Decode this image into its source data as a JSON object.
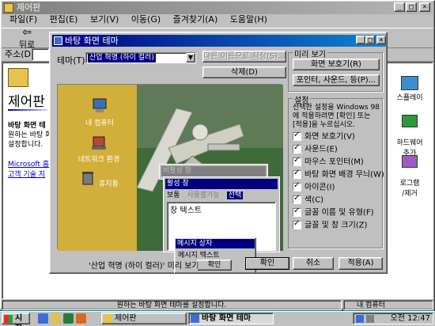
{
  "explorer": {
    "title": "제어판",
    "menu": [
      "파일(F)",
      "편집(E)",
      "보기(V)",
      "이동(G)",
      "즐겨찾기(A)",
      "도움말(H)"
    ],
    "back_label": "뒤로",
    "address_label": "주소(D)",
    "panel_title": "제어판",
    "desc_bold": "바탕 화면 테",
    "desc_line1": "원하는 바탕 화",
    "desc_line2": "설정합니다.",
    "link1": "Microsoft 홈",
    "link2": "고객 기술 지",
    "right_icons": [
      "스플레이",
      "하드웨어\n추가",
      "로그램\n/제거"
    ],
    "status_text": "원하는 바탕 화면 테마를 설정합니다.",
    "status_zone": "내 컴퓨터"
  },
  "dialog": {
    "title": "바탕 화면 테마",
    "theme_label": "테마(T):",
    "theme_value": "산업 혁명 (하이 컬러)",
    "save_as_label": "다른 이름으로 저장(S)...",
    "delete_label": "삭제(D)",
    "preview_group": "미리 보기",
    "screensaver_button": "화면 보호기(R)",
    "pointers_button": "포인터, 사운드, 등(P)...",
    "settings_group": "설정",
    "settings_desc": "선택한 설정을 Windows 98에 적용하려면 [확인] 또는 [적용]을 누르십시오.",
    "checkboxes": [
      {
        "label": "화면 보호기(V)",
        "checked": true
      },
      {
        "label": "사운드(E)",
        "checked": true
      },
      {
        "label": "마우스 포인터(M)",
        "checked": true
      },
      {
        "label": "바탕 화면 배경 무늬(W)",
        "checked": true
      },
      {
        "label": "아이콘(I)",
        "checked": true
      },
      {
        "label": "색(C)",
        "checked": true
      },
      {
        "label": "글꼴 이름 및 유형(F)",
        "checked": true
      },
      {
        "label": "글꼴 및 창 크기(Z)",
        "checked": true
      }
    ],
    "preview_caption": "'산업 혁명 (하이 컬러)' 미리 보기",
    "ok_label": "확인",
    "cancel_label": "취소",
    "apply_label": "적용(A)",
    "preview": {
      "icons": [
        "내 컴퓨터",
        "네트워크 환경",
        "휴지통"
      ],
      "inactive_window": "비활성 창",
      "active_window": "활성 창",
      "menu_normal": "보통",
      "menu_disabled": "사용불가능",
      "menu_selected": "선택",
      "window_text": "창 텍스트",
      "msgbox_title": "메시지 상자",
      "msgbox_text": "메시지 텍스트",
      "msgbox_ok": "확인"
    }
  },
  "taskbar": {
    "start_label": "시작",
    "tasks": [
      "제어판",
      "바탕 화면 테마"
    ],
    "clock": "오전 12:47"
  },
  "colors": {
    "title_active": "#000080",
    "title_inactive": "#808080",
    "face": "#c0c0c0"
  }
}
